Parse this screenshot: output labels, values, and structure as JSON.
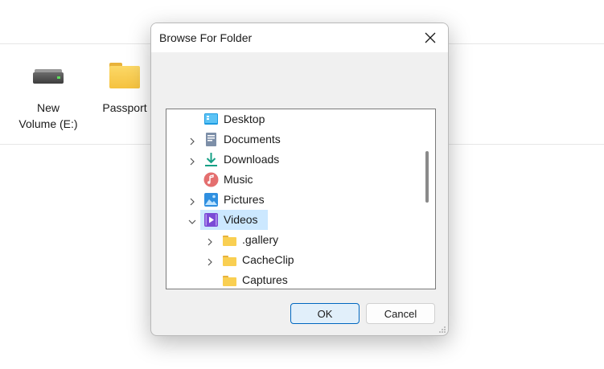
{
  "background": {
    "items": [
      {
        "label": "New\nVolume (E:)",
        "icon": "drive-icon"
      },
      {
        "label": "Passport",
        "icon": "folder-icon"
      }
    ]
  },
  "dialog": {
    "title": "Browse For Folder",
    "close_icon": "close-icon",
    "tree": [
      {
        "label": "Desktop",
        "icon": "desktop-icon",
        "expandable": false,
        "selected": false
      },
      {
        "label": "Documents",
        "icon": "documents-icon",
        "expandable": true,
        "selected": false
      },
      {
        "label": "Downloads",
        "icon": "downloads-icon",
        "expandable": true,
        "selected": false
      },
      {
        "label": "Music",
        "icon": "music-icon",
        "expandable": false,
        "selected": false
      },
      {
        "label": "Pictures",
        "icon": "pictures-icon",
        "expandable": true,
        "selected": false
      },
      {
        "label": "Videos",
        "icon": "videos-icon",
        "expandable": true,
        "expanded": true,
        "selected": true
      },
      {
        "label": ".gallery",
        "icon": "folder-icon",
        "expandable": true,
        "selected": false
      },
      {
        "label": "CacheClip",
        "icon": "folder-icon",
        "expandable": true,
        "selected": false
      },
      {
        "label": "Captures",
        "icon": "folder-icon",
        "expandable": false,
        "selected": false
      }
    ],
    "ok_label": "OK",
    "cancel_label": "Cancel"
  },
  "colors": {
    "selection": "#cce8ff",
    "primary_border": "#0067c0",
    "folder": "#f5c23f"
  }
}
